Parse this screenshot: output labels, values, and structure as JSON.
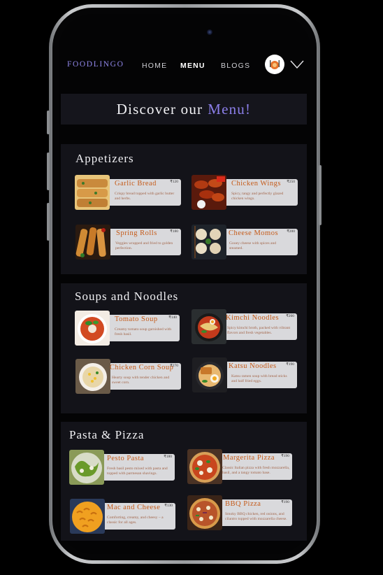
{
  "brand": {
    "prefix": "FOOD",
    "suffix": "LINGO"
  },
  "nav": {
    "home": "HOME",
    "menu": "MENU",
    "blogs": "BLOGS"
  },
  "banner": {
    "text": "Discover our",
    "accent": "Menu!"
  },
  "sections": [
    {
      "title": "Appetizers",
      "items": [
        {
          "name": "Garlic Bread",
          "price": "₹120",
          "desc": "Crispy bread topped with garlic butter and herbs."
        },
        {
          "name": "Chicken Wings",
          "price": "₹250",
          "desc": "Spicy, tangy and perfectly glazed chicken wings."
        },
        {
          "name": "Spring Rolls",
          "price": "₹180",
          "desc": "Veggies wrapped and fried to golden perfection."
        },
        {
          "name": "Cheese Momos",
          "price": "₹200",
          "desc": "Gooey cheese with spices and steamed."
        }
      ]
    },
    {
      "title": "Soups and Noodles",
      "items": [
        {
          "name": "Tomato Soup",
          "price": "₹140",
          "desc": "Creamy tomato soup garnished with fresh basil."
        },
        {
          "name": "Kimchi Noodles",
          "price": "₹260",
          "desc": "Spicy kimchi broth, packed with vibrant flavors and fresh vegetables."
        },
        {
          "name": "Chicken Corn Soup",
          "price": "₹270",
          "desc": "Hearty soup with tender chicken and sweet corn."
        },
        {
          "name": "Katsu Noodles",
          "price": "₹190",
          "desc": "Katsu ramen soup with bread sticks and half fried eggs."
        }
      ]
    },
    {
      "title": "Pasta & Pizza",
      "items": [
        {
          "name": "Pesto Pasta",
          "price": "₹180",
          "desc": "Fresh basil pesto mixed with pasta and topped with parmesan shavings."
        },
        {
          "name": "Margerita Pizza",
          "price": "₹190",
          "desc": "Classic Italian pizza with fresh mozzarella, basil, and a tangy tomato base."
        },
        {
          "name": "Mac and Cheese",
          "price": "₹130",
          "desc": "Comforting, creamy, and cheesy – a classic for all ages."
        },
        {
          "name": "BBQ  Pizza",
          "price": "₹190",
          "desc": "Smoky BBQ chicken, red onions, and cilantro topped with mozzarella cheese."
        }
      ]
    }
  ],
  "icons": {
    "profile": "chef-avatar-icon",
    "menu_toggle": "chevron-down-icon"
  },
  "colors": {
    "accent": "#8b7ee8",
    "item_name": "#c55a18",
    "card_bg": "#d9d9dc",
    "section_bg": "#131319"
  }
}
